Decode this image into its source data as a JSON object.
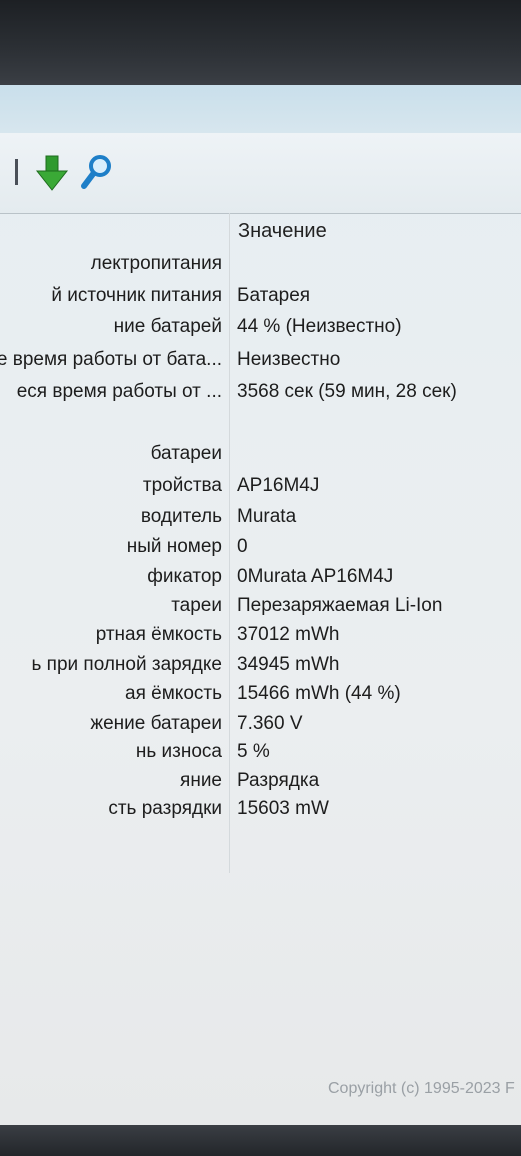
{
  "table": {
    "header": {
      "value_label": "Значение"
    },
    "rows": [
      {
        "label": "лектропитания",
        "value": ""
      },
      {
        "label": "й источник питания",
        "value": "Батарея"
      },
      {
        "label": "ние батарей",
        "value": "44 % (Неизвестно)"
      },
      {
        "label": "е время работы от бата...",
        "value": "Неизвестно"
      },
      {
        "label": "еся время работы от ...",
        "value": "3568 сек (59 мин, 28 сек)"
      },
      {
        "label": "",
        "value": ""
      },
      {
        "label": "батареи",
        "value": ""
      },
      {
        "label": "тройства",
        "value": "AP16M4J"
      },
      {
        "label": "водитель",
        "value": "Murata"
      },
      {
        "label": "ный номер",
        "value": "0"
      },
      {
        "label": "фикатор",
        "value": "0Murata AP16M4J"
      },
      {
        "label": "тареи",
        "value": "Перезаряжаемая Li-Ion"
      },
      {
        "label": "ртная ёмкость",
        "value": "37012 mWh"
      },
      {
        "label": "ь при полной зарядке",
        "value": "34945 mWh"
      },
      {
        "label": "ая ёмкость",
        "value": "15466 mWh  (44 %)"
      },
      {
        "label": "жение батареи",
        "value": "7.360 V"
      },
      {
        "label": "нь износа",
        "value": "5 %"
      },
      {
        "label": "яние",
        "value": "Разрядка"
      },
      {
        "label": "сть разрядки",
        "value": "15603 mW"
      }
    ]
  },
  "footer": {
    "copyright": "Copyright (c) 1995-2023 F"
  },
  "icons": {
    "toolbar_down": "arrow-down-icon",
    "toolbar_find": "magnifier-icon"
  },
  "colors": {
    "arrow_green": "#2f9a2e",
    "magnifier_blue": "#1e7fc8"
  }
}
